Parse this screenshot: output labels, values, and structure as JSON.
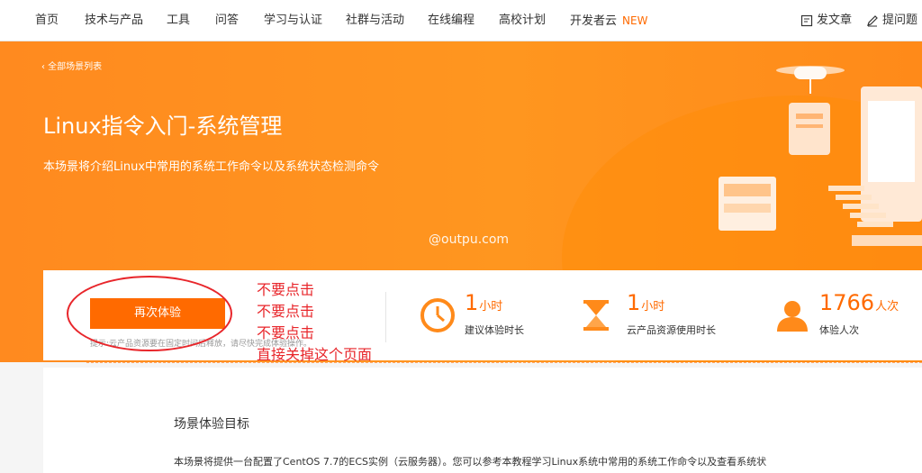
{
  "nav": {
    "items": [
      "首页",
      "技术与产品",
      "工具",
      "问答",
      "学习与认证",
      "社群与活动",
      "在线编程",
      "高校计划",
      "开发者云"
    ],
    "new_badge": "NEW",
    "write_article": "发文章",
    "ask_question": "提问题"
  },
  "hero": {
    "back_link": "‹ 全部场景列表",
    "title": "Linux指令入门-系统管理",
    "subtitle": "本场景将介绍Linux中常用的系统工作命令以及系统状态检测命令",
    "watermark": "@outpu.com"
  },
  "card": {
    "button_label": "再次体验",
    "hint": "提示:云产品资源要在固定时间后释放，请尽快完成体验操作。",
    "stats": [
      {
        "value": "1",
        "unit": "小时",
        "label": "建议体验时长",
        "icon": "clock-icon"
      },
      {
        "value": "1",
        "unit": "小时",
        "label": "云产品资源使用时长",
        "icon": "hourglass-icon"
      },
      {
        "value": "1766",
        "unit": "人次",
        "label": "体验人次",
        "icon": "user-icon"
      }
    ]
  },
  "annotation": {
    "lines": [
      "不要点击",
      "不要点击",
      "不要点击",
      "直接关掉这个页面"
    ]
  },
  "content": {
    "section_title": "场景体验目标",
    "section_body": "本场景将提供一台配置了CentOS 7.7的ECS实例（云服务器）。您可以参考本教程学习Linux系统中常用的系统工作命令以及查看系统状"
  },
  "colors": {
    "accent": "#ff6a00",
    "hero_bg": "#ff8f1c",
    "annotation": "#e8262b"
  }
}
